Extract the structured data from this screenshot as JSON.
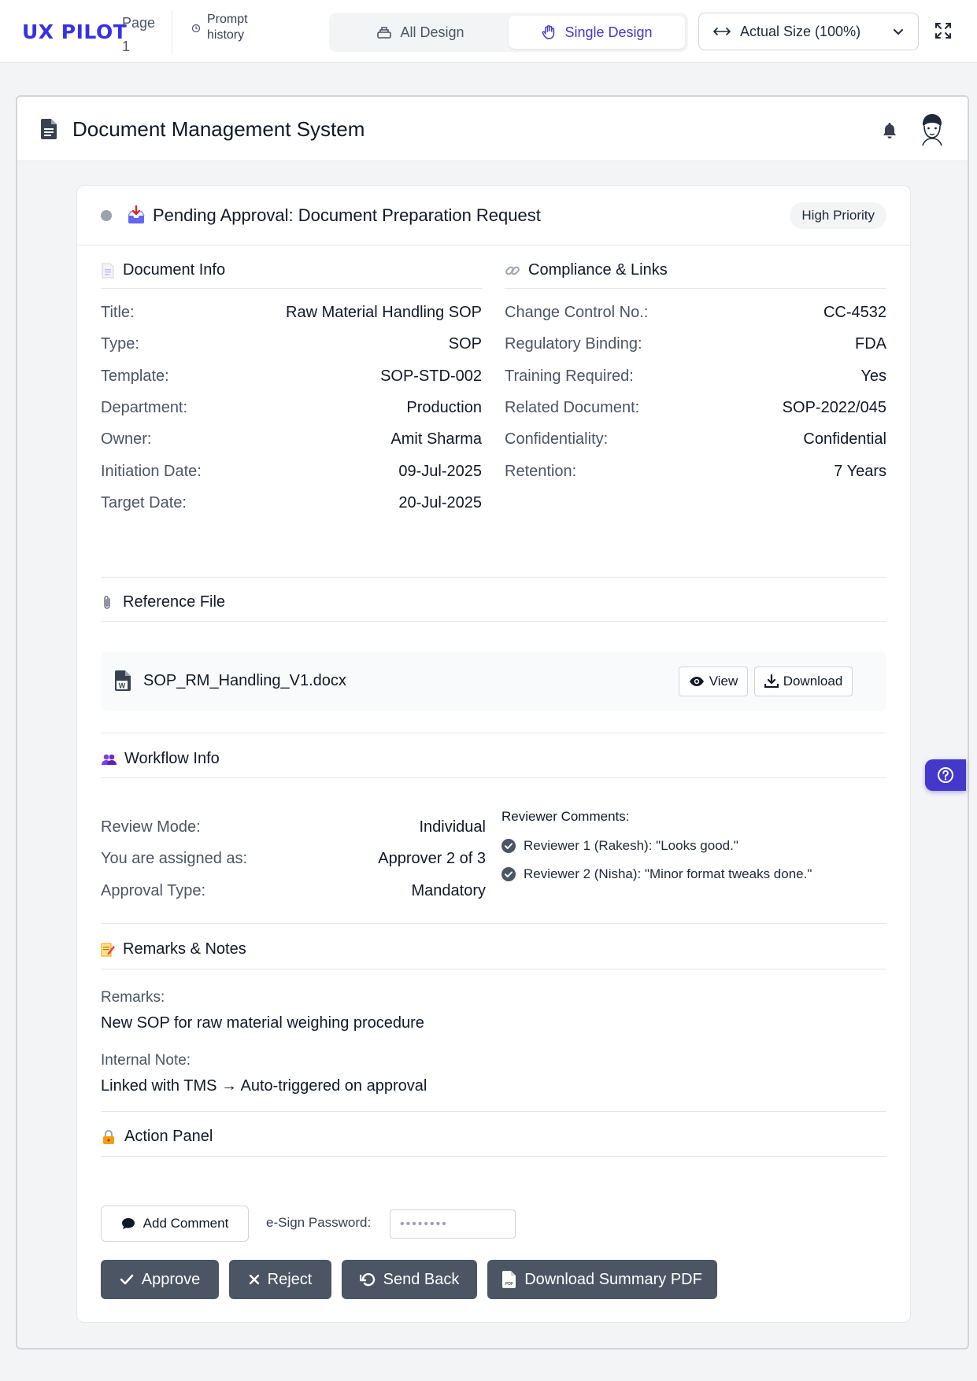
{
  "topbar": {
    "logo": "UX PILOT",
    "page_label": "Page",
    "page_number": "1",
    "prompt_line1": "Prompt",
    "prompt_line2": "history",
    "view_all": "All Design",
    "view_single": "Single Design",
    "zoom_value": "Actual Size (100%)",
    "accent_color": "#3730e6"
  },
  "app": {
    "title": "Document Management System"
  },
  "card": {
    "title": "Pending Approval: Document Preparation Request",
    "priority": "High Priority"
  },
  "document_info": {
    "heading": "Document Info",
    "rows": [
      {
        "label": "Title:",
        "value": "Raw Material Handling SOP"
      },
      {
        "label": "Type:",
        "value": "SOP"
      },
      {
        "label": "Template:",
        "value": "SOP-STD-002"
      },
      {
        "label": "Department:",
        "value": "Production"
      },
      {
        "label": "Owner:",
        "value": "Amit Sharma"
      },
      {
        "label": "Initiation Date:",
        "value": "09-Jul-2025"
      },
      {
        "label": "Target Date:",
        "value": "20-Jul-2025"
      }
    ]
  },
  "compliance": {
    "heading": "Compliance & Links",
    "rows": [
      {
        "label": "Change Control No.:",
        "value": "CC-4532"
      },
      {
        "label": "Regulatory Binding:",
        "value": "FDA"
      },
      {
        "label": "Training Required:",
        "value": "Yes"
      },
      {
        "label": "Related Document:",
        "value": "SOP-2022/045"
      },
      {
        "label": "Confidentiality:",
        "value": "Confidential"
      },
      {
        "label": "Retention:",
        "value": "7 Years"
      }
    ]
  },
  "reference": {
    "heading": "Reference File",
    "filename": "SOP_RM_Handling_V1.docx",
    "view_label": "View",
    "download_label": "Download"
  },
  "workflow": {
    "heading": "Workflow Info",
    "rows": [
      {
        "label": "Review Mode:",
        "value": "Individual"
      },
      {
        "label": "You are assigned as:",
        "value": "Approver 2 of 3"
      },
      {
        "label": "Approval Type:",
        "value": "Mandatory"
      }
    ],
    "comments_heading": "Reviewer Comments:",
    "comments": [
      "Reviewer 1 (Rakesh): \"Looks good.\"",
      "Reviewer 2 (Nisha): \"Minor format tweaks done.\""
    ]
  },
  "remarks": {
    "heading": "Remarks & Notes",
    "remarks_label": "Remarks:",
    "remarks_text": "New SOP for raw material weighing procedure",
    "note_label": "Internal Note:",
    "note_text": "Linked with TMS → Auto-triggered on approval"
  },
  "actions": {
    "heading": "Action Panel",
    "add_comment": "Add Comment",
    "esign_label": "e-Sign Password:",
    "esign_value": "••••••••",
    "approve": "Approve",
    "reject": "Reject",
    "send_back": "Send Back",
    "download_pdf": "Download Summary PDF"
  }
}
